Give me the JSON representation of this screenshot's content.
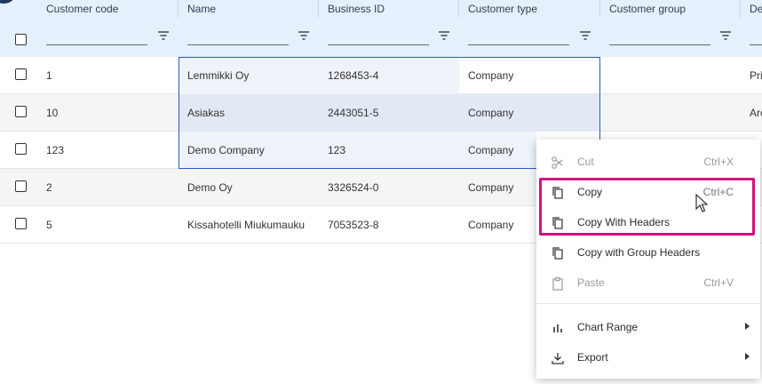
{
  "grid": {
    "columns": [
      {
        "label": "Customer code"
      },
      {
        "label": "Name"
      },
      {
        "label": "Business ID"
      },
      {
        "label": "Customer type"
      },
      {
        "label": "Customer group"
      },
      {
        "label": "De"
      }
    ],
    "rows": [
      {
        "code": "1",
        "name": "Lemmikki Oy",
        "business_id": "1268453-4",
        "type": "Company",
        "group": "",
        "extra": "Pri"
      },
      {
        "code": "10",
        "name": "Asiakas",
        "business_id": "2443051-5",
        "type": "Company",
        "group": "",
        "extra": "Arc"
      },
      {
        "code": "123",
        "name": "Demo Company",
        "business_id": "123",
        "type": "Company",
        "group": "",
        "extra": ""
      },
      {
        "code": "2",
        "name": "Demo Oy",
        "business_id": "3326524-0",
        "type": "Company",
        "group": "",
        "extra": ""
      },
      {
        "code": "5",
        "name": "Kissahotelli Miukumauku",
        "business_id": "7053523-8",
        "type": "Company",
        "group": "",
        "extra": ""
      }
    ]
  },
  "context_menu": {
    "cut": {
      "label": "Cut",
      "shortcut": "Ctrl+X",
      "icon": "scissors-icon"
    },
    "copy": {
      "label": "Copy",
      "shortcut": "Ctrl+C",
      "icon": "copy-icon"
    },
    "copy_headers": {
      "label": "Copy With Headers",
      "icon": "copy-icon"
    },
    "copy_group_headers": {
      "label": "Copy with Group Headers",
      "icon": "copy-icon"
    },
    "paste": {
      "label": "Paste",
      "shortcut": "Ctrl+V",
      "icon": "clipboard-icon"
    },
    "chart_range": {
      "label": "Chart Range",
      "icon": "bar-chart-icon"
    },
    "export": {
      "label": "Export",
      "icon": "download-icon"
    }
  },
  "colors": {
    "header_bg": "#e4f0fb",
    "selection_border": "#2f57c6",
    "highlight_border": "#d2127d"
  }
}
